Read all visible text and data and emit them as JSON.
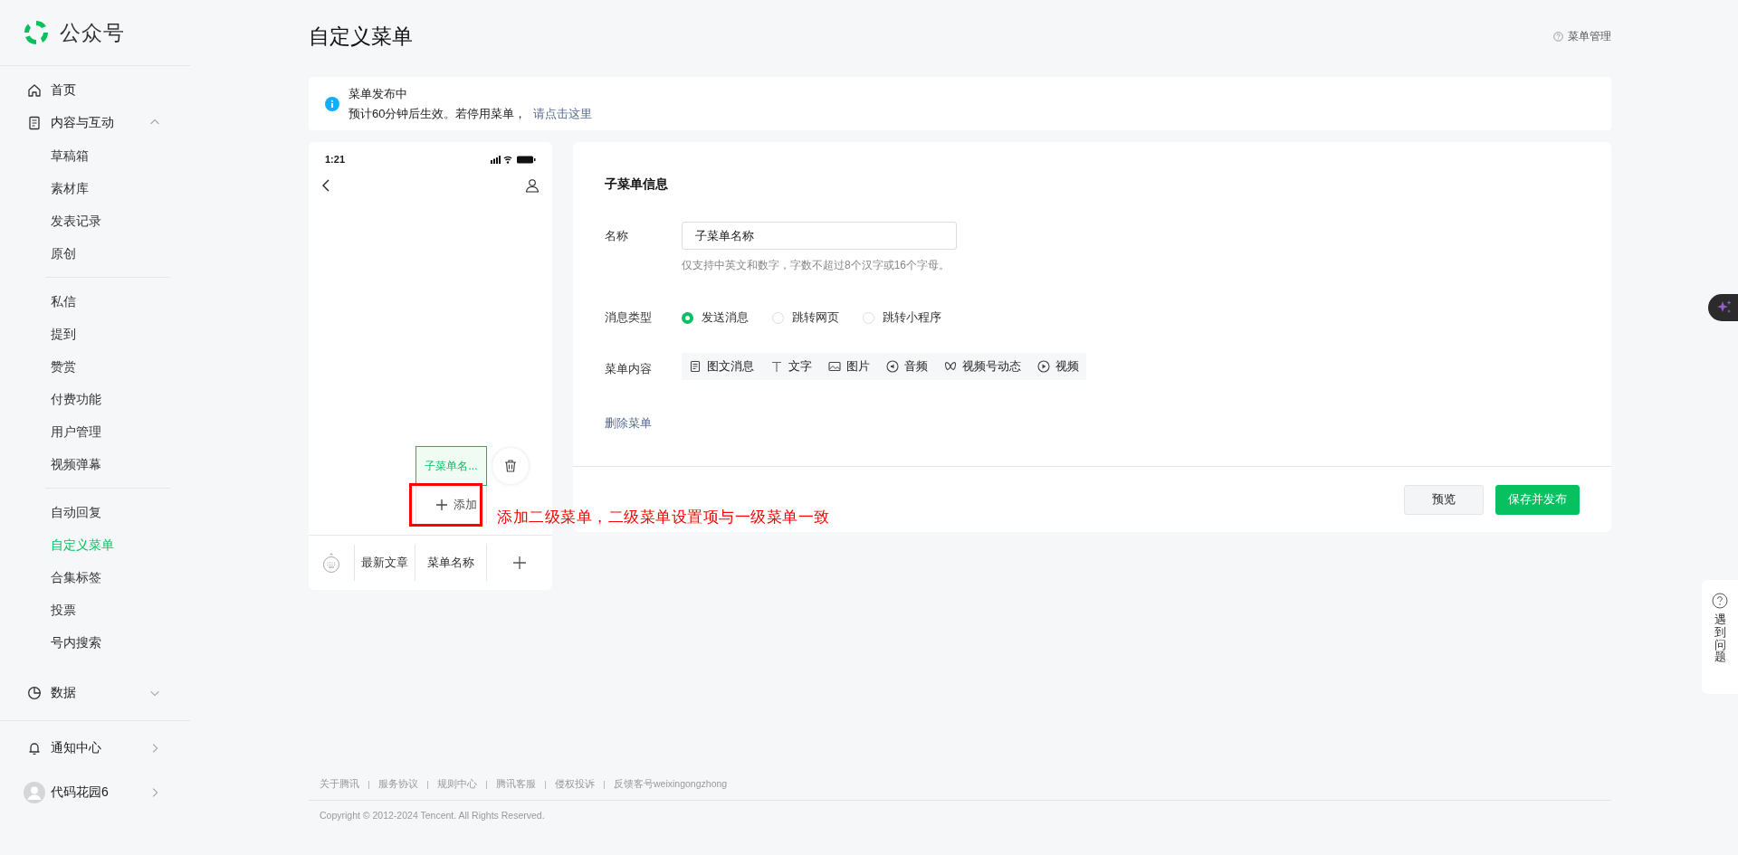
{
  "brand": {
    "name": "公众号"
  },
  "sidebar": {
    "items": [
      {
        "kind": "home",
        "label": "首页"
      },
      {
        "kind": "content",
        "label": "内容与互动",
        "expanded": true,
        "sections": [
          [
            {
              "label": "草稿箱",
              "selected": false
            },
            {
              "label": "素材库",
              "selected": false
            },
            {
              "label": "发表记录",
              "selected": false
            },
            {
              "label": "原创",
              "selected": false
            }
          ],
          [
            {
              "label": "私信",
              "selected": false
            },
            {
              "label": "提到",
              "selected": false
            },
            {
              "label": "赞赏",
              "selected": false
            },
            {
              "label": "付费功能",
              "selected": false
            },
            {
              "label": "用户管理",
              "selected": false
            },
            {
              "label": "视频弹幕",
              "selected": false
            }
          ],
          [
            {
              "label": "自动回复",
              "selected": false
            },
            {
              "label": "自定义菜单",
              "selected": true
            },
            {
              "label": "合集标签",
              "selected": false
            },
            {
              "label": "投票",
              "selected": false
            },
            {
              "label": "号内搜索",
              "selected": false
            }
          ]
        ]
      },
      {
        "kind": "data",
        "label": "数据",
        "expanded": false
      },
      {
        "kind": "notifications",
        "label": "通知中心"
      },
      {
        "kind": "account",
        "label": "代码花园6"
      }
    ]
  },
  "page": {
    "title": "自定义菜单",
    "help_link": "菜单管理"
  },
  "notice": {
    "title": "菜单发布中",
    "text": "预计60分钟后生效。若停用菜单，",
    "link": "请点击这里"
  },
  "phone": {
    "time": "1:21",
    "submenu_items": [
      {
        "label": "子菜单名...",
        "selected": true
      }
    ],
    "add_label": "添加",
    "menu_items": [
      {
        "label": "最新文章"
      },
      {
        "label": "菜单名称"
      }
    ]
  },
  "annotation": {
    "text": "添加二级菜单，二级菜单设置项与一级菜单一致"
  },
  "form": {
    "title": "子菜单信息",
    "name_label": "名称",
    "name_value": "子菜单名称",
    "name_hint": "仅支持中英文和数字，字数不超过8个汉字或16个字母。",
    "type_label": "消息类型",
    "types": [
      {
        "label": "发送消息",
        "selected": true
      },
      {
        "label": "跳转网页",
        "selected": false
      },
      {
        "label": "跳转小程序",
        "selected": false
      }
    ],
    "content_label": "菜单内容",
    "content_tabs": [
      {
        "kind": "article",
        "label": "图文消息"
      },
      {
        "kind": "text",
        "label": "文字"
      },
      {
        "kind": "image",
        "label": "图片"
      },
      {
        "kind": "audio",
        "label": "音频"
      },
      {
        "kind": "channels",
        "label": "视频号动态"
      },
      {
        "kind": "video",
        "label": "视频"
      }
    ],
    "delete_link": "删除菜单",
    "buttons": [
      {
        "kind": "secondary",
        "label": "预览"
      },
      {
        "kind": "primary",
        "label": "保存并发布"
      }
    ]
  },
  "footer": {
    "links": [
      "关于腾讯",
      "服务协议",
      "规则中心",
      "腾讯客服",
      "侵权投诉",
      "反馈客号weixingongzhong"
    ],
    "copyright": "Copyright © 2012-2024 Tencent. All Rights Reserved."
  },
  "help_widget": {
    "label": "遇到问题"
  }
}
